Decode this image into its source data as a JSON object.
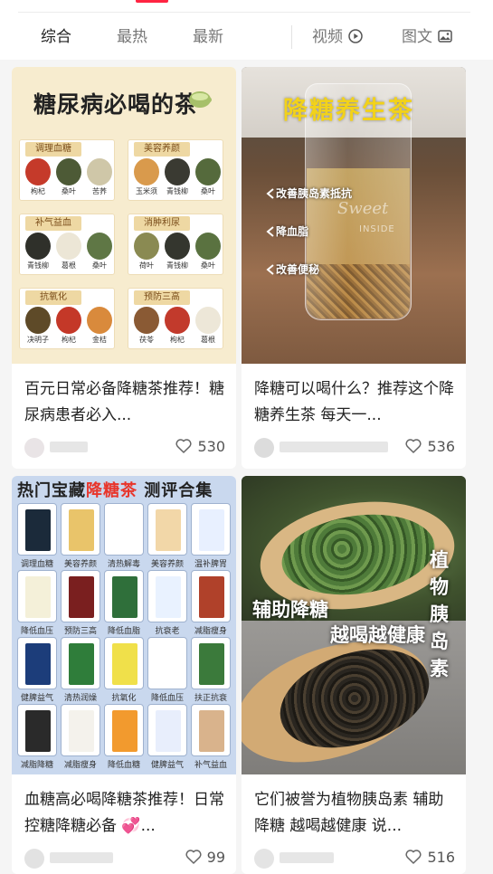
{
  "tabs": {
    "comprehensive": "综合",
    "hottest": "最热",
    "latest": "最新",
    "video": "视频",
    "image_text": "图文"
  },
  "cards": [
    {
      "title": "百元日常必备降糖茶推荐！糖尿病患者必入...",
      "likes": "530",
      "image": {
        "heading": "糖尿病必喝的茶",
        "groups": [
          {
            "name": "调理血糖",
            "items": [
              "枸杞",
              "桑叶",
              "苦荞"
            ]
          },
          {
            "name": "美容养颜",
            "items": [
              "玉米须",
              "青钱柳",
              "桑叶"
            ]
          },
          {
            "name": "补气益血",
            "items": [
              "青钱柳",
              "葛根",
              "桑叶"
            ]
          },
          {
            "name": "消肿利尿",
            "items": [
              "荷叶",
              "青钱柳",
              "桑叶"
            ]
          },
          {
            "name": "抗氧化",
            "items": [
              "决明子",
              "枸杞",
              "金桔"
            ]
          },
          {
            "name": "预防三高",
            "items": [
              "茯苓",
              "枸杞",
              "葛根"
            ]
          }
        ]
      }
    },
    {
      "title": "降糖可以喝什么？推荐这个降糖养生茶 每天一...",
      "likes": "536",
      "image": {
        "heading": "降糖养生茶",
        "labels": [
          "改善胰岛素抵抗",
          "降血脂",
          "改善便秘"
        ],
        "glass_script": "Sweet",
        "glass_text": "INSIDE"
      }
    },
    {
      "title": "血糖高必喝降糖茶推荐！日常控糖降糖必备 💞...",
      "likes": "99",
      "image": {
        "heading_prefix": "热门宝藏",
        "heading_highlight": "降糖茶",
        "heading_suffix": "测评合集",
        "products": [
          "调理血糖",
          "美容养颜",
          "清热解毒",
          "美容养颜",
          "温补脾胃",
          "降低血压",
          "预防三高",
          "降低血脂",
          "抗衰老",
          "减脂瘦身",
          "健脾益气",
          "清热润燥",
          "抗氧化",
          "降低血压",
          "扶正抗衰",
          "减脂降糖",
          "减脂瘦身",
          "降低血糖",
          "健脾益气",
          "补气益血"
        ]
      }
    },
    {
      "title": "它们被誉为植物胰岛素 辅助降糖 越喝越健康 说...",
      "likes": "516",
      "image": {
        "caption1": "辅助降糖",
        "caption2": "越喝越健康",
        "vertical": "植物胰岛素"
      }
    }
  ],
  "colors": {
    "accent": "#ff2442",
    "tea_yellow": "#f2d21a",
    "highlight_red": "#e8352b"
  }
}
